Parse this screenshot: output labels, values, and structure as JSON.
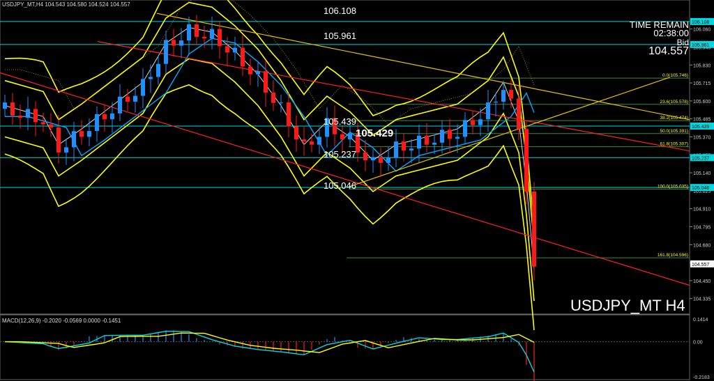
{
  "header": {
    "symbol_tf": "USDJPY_MT,H4",
    "ohlc": "104.543 104.580 104.524 104.557"
  },
  "overlay": {
    "time_remain_label": "TIME REMAIN",
    "time_remain_value": "02:38:00",
    "bid_label": "Bid",
    "bid_value": "104.557",
    "symbol_big": "USDJPY_MT H4"
  },
  "levels": {
    "l1": "106.108",
    "l2": "105.961",
    "l3": "105.439",
    "l4": "105.429",
    "l5": "105.237",
    "l6": "105.046"
  },
  "fibo": [
    "0.0(105.746)",
    "23.6(105.578)",
    "38.2(105.474)",
    "50.0(105.391)",
    "61.8(105.307)",
    "100.0(105.035)",
    "161.8(104.596)"
  ],
  "colors": {
    "background": "#000000",
    "bull": "#1e90ff",
    "bear": "#ff1a1a",
    "bands": "#ffff00",
    "trend_red": "#ff2020",
    "trend_yellow": "#e6c200",
    "cyan": "#00d8e0"
  },
  "chart_data": {
    "type": "candlestick",
    "price_axis_ticks": [
      "106.060",
      "105.945",
      "105.830",
      "105.715",
      "105.600",
      "105.485",
      "105.370",
      "105.255",
      "105.140",
      "105.025",
      "104.910",
      "104.795",
      "104.680",
      "104.565",
      "104.450",
      "104.335"
    ],
    "price_range": [
      104.24,
      106.21
    ],
    "axis_badges": [
      {
        "value": "106.108",
        "price": 106.108
      },
      {
        "value": "105.961",
        "price": 105.961
      },
      {
        "value": "105.439",
        "price": 105.439
      },
      {
        "value": "105.237",
        "price": 105.237
      },
      {
        "value": "105.046",
        "price": 105.046
      },
      {
        "value": "104.557",
        "price": 104.557
      }
    ],
    "macd": {
      "label": "MACD(12,26,9) -0.2020 -0.0569 0.0000 -0.1451",
      "ticks": [
        "0.1414",
        "0.00",
        "-0.2183"
      ],
      "range": [
        -0.2183,
        0.1414
      ]
    }
  }
}
